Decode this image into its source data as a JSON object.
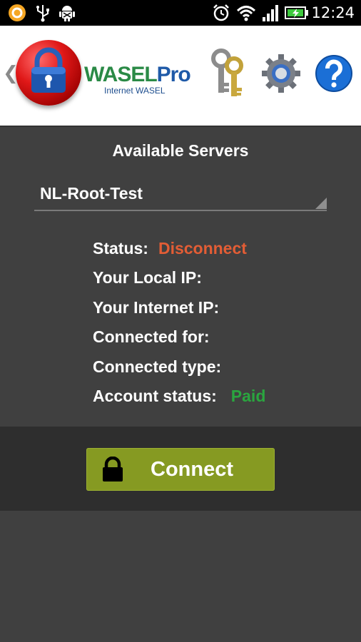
{
  "status_bar": {
    "time": "12:24",
    "icons": [
      "notification-app-icon",
      "usb-icon",
      "android-debug-icon",
      "alarm-icon",
      "wifi-icon",
      "signal-icon",
      "battery-charging-icon"
    ]
  },
  "header": {
    "back_glyph": "❮",
    "logo": {
      "brand_main": "WASEL",
      "brand_pro": "Pro",
      "tagline": "Internet WASEL"
    },
    "buttons": [
      "keys-icon",
      "settings-gear-icon",
      "help-icon"
    ]
  },
  "servers": {
    "title": "Available Servers",
    "selected": "NL-Root-Test"
  },
  "info": {
    "status_label": "Status:",
    "status_value": "Disconnect",
    "local_ip_label": "Your Local IP:",
    "internet_ip_label": "Your Internet IP:",
    "connected_for_label": "Connected for:",
    "connected_type_label": "Connected type:",
    "account_status_label": "Account status:",
    "account_status_value": "Paid"
  },
  "colors": {
    "status_disconnect": "#e35d35",
    "account_paid": "#2aa53f",
    "connect_button": "#869a22",
    "panel_background": "#404040"
  },
  "connect": {
    "label": "Connect",
    "icon": "lock-icon"
  }
}
